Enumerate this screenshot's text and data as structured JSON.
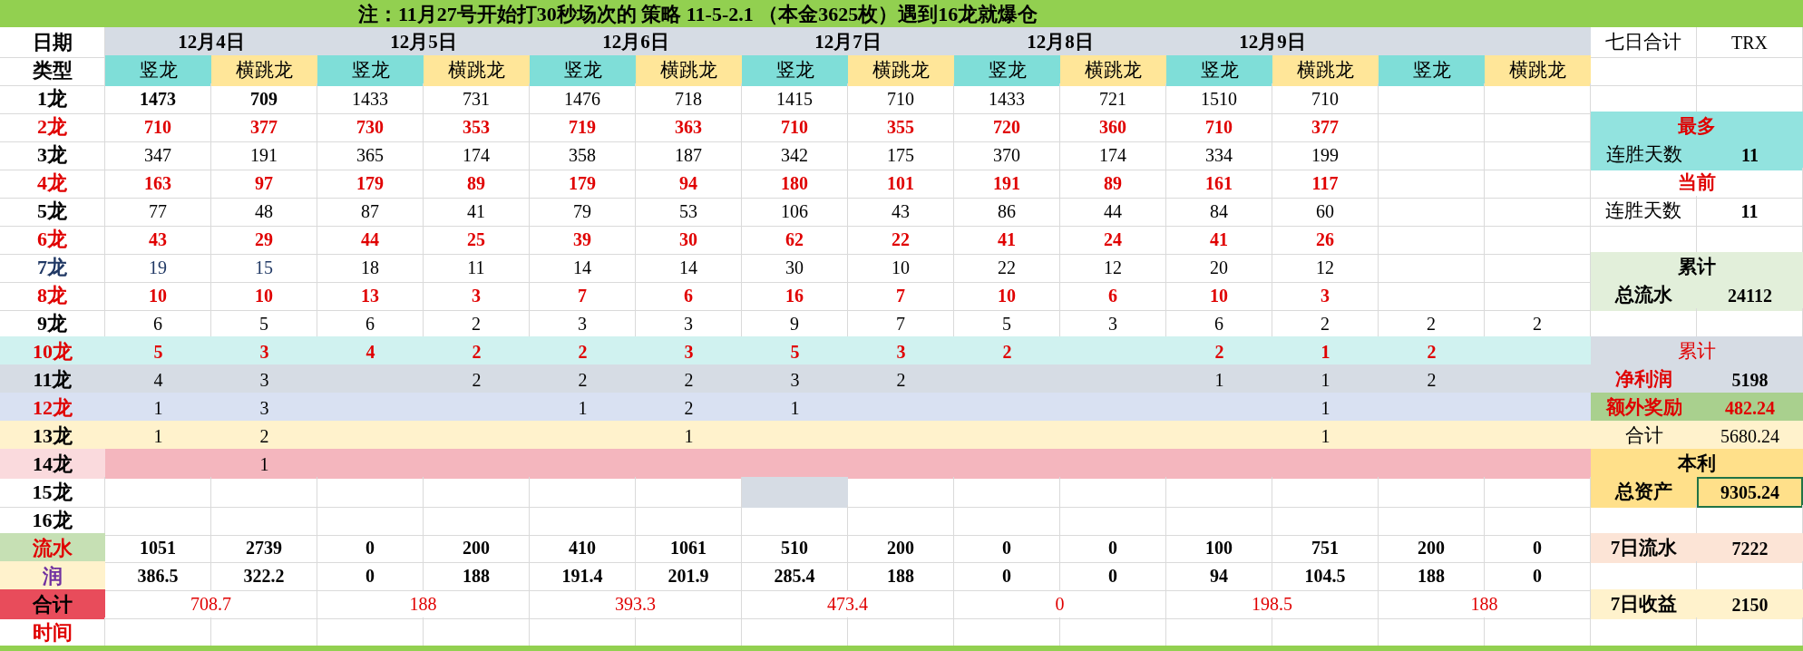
{
  "banner": "注：11月27号开始打30秒场次的 策略 11-5-2.1 （本金3625枚）遇到16龙就爆仓",
  "header": {
    "label": "日期",
    "dates": [
      "12月4日",
      "12月5日",
      "12月6日",
      "12月7日",
      "12月8日",
      "12月9日"
    ],
    "summary": {
      "kind": "pair",
      "label": "七日合计",
      "value": "TRX",
      "label_bold": false,
      "label_red": false,
      "value_bold": false,
      "value_red": false,
      "selected": false
    }
  },
  "types": {
    "label": "类型",
    "items": [
      {
        "text": "竖龙",
        "kind": "vertical"
      },
      {
        "text": "横跳龙",
        "kind": "jump"
      },
      {
        "text": "竖龙",
        "kind": "vertical"
      },
      {
        "text": "横跳龙",
        "kind": "jump"
      },
      {
        "text": "竖龙",
        "kind": "vertical"
      },
      {
        "text": "横跳龙",
        "kind": "jump"
      },
      {
        "text": "竖龙",
        "kind": "vertical"
      },
      {
        "text": "横跳龙",
        "kind": "jump"
      },
      {
        "text": "竖龙",
        "kind": "vertical"
      },
      {
        "text": "横跳龙",
        "kind": "jump"
      },
      {
        "text": "竖龙",
        "kind": "vertical"
      },
      {
        "text": "横跳龙",
        "kind": "jump"
      },
      {
        "text": "竖龙",
        "kind": "vertical"
      },
      {
        "text": "横跳龙",
        "kind": "jump"
      }
    ]
  },
  "rows": [
    {
      "label": {
        "text": "1龙"
      },
      "kind": "plain",
      "cells": [
        {
          "text": "1473",
          "bold": true
        },
        {
          "text": "709",
          "bold": true
        },
        "1433",
        "731",
        "1476",
        "718",
        "1415",
        "710",
        "1433",
        "721",
        "1510",
        "710",
        null,
        null
      ]
    },
    {
      "label": {
        "text": "2龙"
      },
      "kind": "red",
      "cells": [
        "710",
        "377",
        "730",
        "353",
        "719",
        "363",
        "710",
        "355",
        "720",
        "360",
        "710",
        "377",
        null,
        null
      ],
      "summary": {
        "kind": "heading",
        "label": "最多",
        "label_bold": true,
        "label_red": true,
        "color": "#92e3df"
      }
    },
    {
      "label": {
        "text": "3龙"
      },
      "kind": "plain",
      "cells": [
        "347",
        "191",
        "365",
        "174",
        "358",
        "187",
        "342",
        "175",
        "370",
        "174",
        "334",
        "199",
        null,
        null
      ],
      "summary": {
        "kind": "pair",
        "label": "连胜天数",
        "value": "11",
        "label_bold": false,
        "label_red": false,
        "value_bold": true,
        "value_red": false,
        "color": "#92e3df",
        "selected": false
      }
    },
    {
      "label": {
        "text": "4龙"
      },
      "kind": "red",
      "cells": [
        "163",
        "97",
        "179",
        "89",
        "179",
        "94",
        "180",
        "101",
        "191",
        "89",
        "161",
        "117",
        null,
        null
      ],
      "summary": {
        "kind": "heading",
        "label": "当前",
        "label_bold": true,
        "label_red": true
      }
    },
    {
      "label": {
        "text": "5龙"
      },
      "kind": "plain",
      "cells": [
        "77",
        "48",
        "87",
        "41",
        "79",
        "53",
        "106",
        "43",
        "86",
        "44",
        "84",
        "60",
        null,
        null
      ],
      "summary": {
        "kind": "pair",
        "label": "连胜天数",
        "value": "11",
        "label_bold": false,
        "label_red": false,
        "value_bold": true,
        "value_red": false,
        "selected": false
      }
    },
    {
      "label": {
        "text": "6龙"
      },
      "kind": "red",
      "cells": [
        "43",
        "29",
        "44",
        "25",
        "39",
        "30",
        "62",
        "22",
        "41",
        "24",
        "41",
        "26",
        null,
        null
      ]
    },
    {
      "label": {
        "text": "7龙"
      },
      "kind": "navy",
      "cells": [
        {
          "text": "19",
          "navy": true
        },
        {
          "text": "15",
          "navy": true
        },
        "18",
        "11",
        "14",
        "14",
        "30",
        "10",
        "22",
        "12",
        "20",
        "12",
        null,
        null
      ],
      "summary": {
        "kind": "heading",
        "label": "累计",
        "label_bold": true,
        "label_red": false,
        "color": "#e2efda"
      }
    },
    {
      "label": {
        "text": "8龙"
      },
      "kind": "red",
      "cells": [
        "10",
        "10",
        "13",
        "3",
        "7",
        "6",
        "16",
        "7",
        "10",
        "6",
        "10",
        "3",
        null,
        null
      ],
      "summary": {
        "kind": "pair",
        "label": "总流水",
        "value": "24112",
        "label_bold": true,
        "label_red": false,
        "value_bold": true,
        "value_red": false,
        "color": "#e2efda",
        "selected": false
      }
    },
    {
      "label": {
        "text": "9龙"
      },
      "kind": "plain",
      "cells": [
        "6",
        "5",
        "6",
        "2",
        "3",
        "3",
        "9",
        "7",
        "5",
        "3",
        "6",
        "2",
        "2",
        "2"
      ]
    },
    {
      "label": {
        "text": "10龙",
        "color": "#d0f2f0"
      },
      "kind": "red",
      "color": "#d0f2f0",
      "cells": [
        "5",
        "3",
        "4",
        "2",
        "2",
        "3",
        "5",
        "3",
        "2",
        null,
        "2",
        "1",
        "2",
        null
      ],
      "summary": {
        "kind": "heading",
        "label": "累计",
        "label_bold": false,
        "label_red": true,
        "color": "#d6dce4"
      }
    },
    {
      "label": {
        "text": "11龙",
        "color": "#d6dce4"
      },
      "kind": "plain",
      "color": "#d6dce4",
      "cells": [
        "4",
        "3",
        null,
        "2",
        "2",
        "2",
        "3",
        "2",
        null,
        null,
        "1",
        "1",
        "2",
        null
      ],
      "summary": {
        "kind": "pair",
        "label": "净利润",
        "value": "5198",
        "label_bold": true,
        "label_red": true,
        "value_bold": true,
        "value_red": false,
        "color": "#d6dce4",
        "selected": false
      }
    },
    {
      "label": {
        "text": "12龙",
        "color": "#d9e1f2"
      },
      "kind": "red-label",
      "color": "#d9e1f2",
      "cells": [
        "1",
        "3",
        null,
        null,
        "1",
        "2",
        "1",
        null,
        null,
        null,
        null,
        "1",
        null,
        null
      ],
      "summary": {
        "kind": "pair",
        "label": "额外奖励",
        "value": "482.24",
        "label_bold": true,
        "label_red": true,
        "value_bold": true,
        "value_red": true,
        "color": "#a9d08e",
        "selected": false
      }
    },
    {
      "label": {
        "text": "13龙",
        "color": "#fff2cc"
      },
      "kind": "plain",
      "color": "#fff2cc",
      "cells": [
        "1",
        "2",
        null,
        null,
        null,
        "1",
        null,
        null,
        null,
        null,
        null,
        "1",
        null,
        null
      ],
      "summary": {
        "kind": "pair",
        "label": "合计",
        "value": "5680.24",
        "label_bold": false,
        "label_red": false,
        "value_bold": false,
        "value_red": false,
        "color": "#fff2cc",
        "selected": false
      }
    },
    {
      "label": {
        "text": "14龙",
        "color": "#fadadd"
      },
      "kind": "plain",
      "color": "#f4b6be",
      "cells": [
        null,
        "1",
        null,
        null,
        null,
        null,
        null,
        null,
        null,
        null,
        null,
        null,
        null,
        null
      ],
      "summary": {
        "kind": "heading",
        "label": "本利",
        "label_bold": true,
        "label_red": false,
        "color": "#ffe08a"
      }
    },
    {
      "label": {
        "text": "15龙"
      },
      "kind": "plain",
      "cells": [
        null,
        null,
        null,
        null,
        null,
        null,
        {
          "color": "#d6dce4"
        },
        null,
        null,
        null,
        null,
        null,
        null,
        null
      ],
      "summary": {
        "kind": "pair",
        "label": "总资产",
        "value": "9305.24",
        "label_bold": true,
        "label_red": false,
        "value_bold": true,
        "value_red": false,
        "color": "#ffe08a",
        "selected": true
      }
    },
    {
      "label": {
        "text": "16龙"
      },
      "kind": "plain",
      "cells": [
        null,
        null,
        null,
        null,
        null,
        null,
        null,
        null,
        null,
        null,
        null,
        null,
        null,
        null
      ]
    },
    {
      "label": {
        "text": "流水",
        "color": "#c6e0b4"
      },
      "kind": "flow",
      "cells": [
        "1051",
        "2739",
        "0",
        "200",
        "410",
        "1061",
        "510",
        "200",
        "0",
        "0",
        "100",
        "751",
        "200",
        "0"
      ],
      "summary": {
        "kind": "pair",
        "label": "7日流水",
        "value": "7222",
        "label_bold": true,
        "label_red": false,
        "value_bold": true,
        "value_red": false,
        "color": "#fce4d6",
        "selected": false
      }
    },
    {
      "label": {
        "text": "润",
        "color": "#fff2cc"
      },
      "kind": "profit",
      "cells": [
        "386.5",
        "322.2",
        "0",
        "188",
        "191.4",
        "201.9",
        "285.4",
        "188",
        "0",
        "0",
        "94",
        "104.5",
        "188",
        "0"
      ]
    }
  ],
  "totals": {
    "label": {
      "text": "合计",
      "color": "#e84c5b"
    },
    "values": [
      "708.7",
      "188",
      "393.3",
      "473.4",
      "0",
      "198.5",
      "188"
    ],
    "summary": {
      "kind": "pair",
      "label": "7日收益",
      "value": "2150",
      "label_bold": true,
      "label_red": false,
      "value_bold": true,
      "value_red": false,
      "color": "#fff2cc",
      "selected": false
    }
  },
  "time_row": {
    "label": "时间"
  }
}
